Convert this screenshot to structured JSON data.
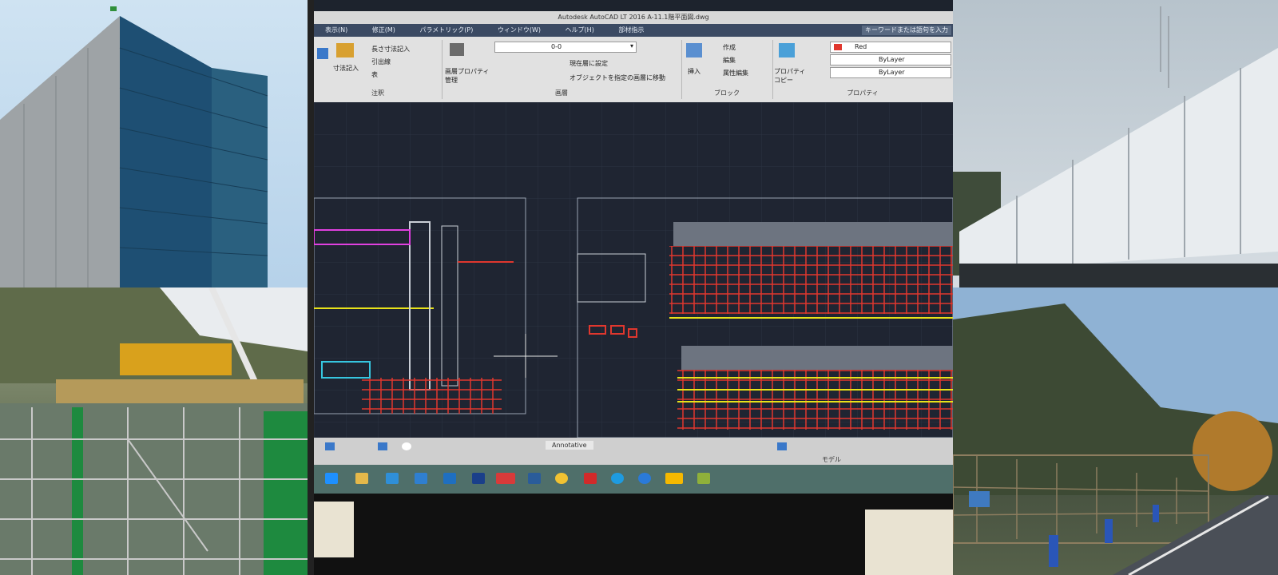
{
  "panels": {
    "building": "scaffold-building",
    "construction": "scaffold-site",
    "monitor": "cad-monitor",
    "fence": "scaffold-fence",
    "road": "roadside-scaffold"
  },
  "cad": {
    "window_title": "Autodesk AutoCAD LT 2016   A-11.1階平面図.dwg",
    "menu": [
      "表示(N)",
      "修正(M)",
      "パラメトリック(P)",
      "ウィンドウ(W)",
      "ヘルプ(H)",
      "部材指示"
    ],
    "search_placeholder": "キーワードまたは語句を入力",
    "ribbon": {
      "annotation": {
        "items": [
          "長さ寸法記入",
          "寸法記入",
          "引出線",
          "表"
        ],
        "label": "注釈"
      },
      "layers": {
        "layer_value": "0-0",
        "properties_button": "画層プロパティ管理",
        "set_current": "現在層に設定",
        "match_layer": "オブジェクトを指定の画層に移動",
        "label": "画層"
      },
      "block": {
        "insert": "挿入",
        "create": "作成",
        "edit": "編集",
        "attribute_edit": "属性編集",
        "label": "ブロック"
      },
      "properties": {
        "copy": "プロパティコピー",
        "color": "Red",
        "linetype": "ByLayer",
        "lineweight": "ByLayer",
        "label": "プロパティ"
      }
    },
    "status": {
      "annotation_scale": "Annotative",
      "model_tab": "モデル"
    }
  },
  "icons": {
    "taskbar": [
      "windows-start-icon",
      "file-explorer-icon",
      "store-icon",
      "mail-icon",
      "outlook-icon",
      "jw-icon",
      "autocad-icon",
      "browser-icon",
      "chrome-icon",
      "acrobat-icon",
      "skype-icon",
      "edge-icon",
      "notes-icon",
      "app-icon"
    ]
  },
  "colors": {
    "cad_background": "#1f2532",
    "cad_red": "#e0372e",
    "cad_yellow": "#e8e21a",
    "scaffold_green": "#1e8a3f"
  }
}
